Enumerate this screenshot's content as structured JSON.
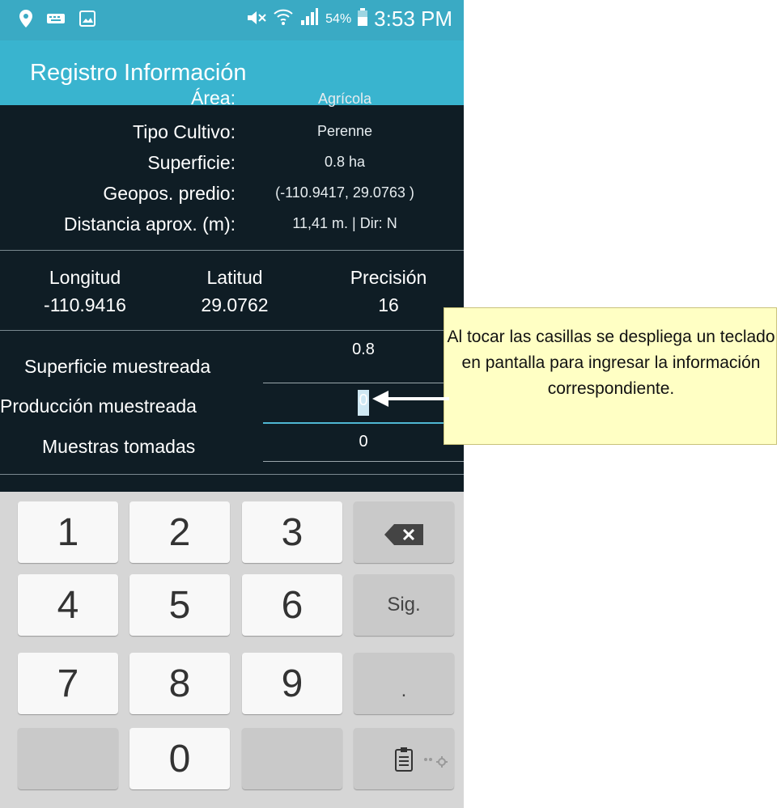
{
  "status_bar": {
    "battery_percent": "54%",
    "time": "3:53 PM"
  },
  "app": {
    "title": "Registro Información"
  },
  "info": {
    "partial_label": "Área:",
    "partial_value": "Agrícola",
    "rows": [
      {
        "label": "Tipo Cultivo:",
        "value": "Perenne"
      },
      {
        "label": "Superficie:",
        "value": "0.8 ha"
      },
      {
        "label": "Geopos. predio:",
        "value": "(-110.9417, 29.0763 )"
      },
      {
        "label": "Distancia aprox. (m):",
        "value": "11,41 m. | Dir: N"
      }
    ]
  },
  "gps": {
    "longitud_label": "Longitud",
    "longitud_value": "-110.9416",
    "latitud_label": "Latitud",
    "latitud_value": "29.0762",
    "precision_label": "Precisión",
    "precision_value": "16"
  },
  "form": {
    "superficie_label": "Superficie muestreada",
    "superficie_value": "0.8",
    "produccion_label": "Producción muestreada",
    "produccion_value": "0",
    "muestras_label": "Muestras tomadas",
    "muestras_value": "0"
  },
  "keyboard": {
    "k1": "1",
    "k2": "2",
    "k3": "3",
    "k4": "4",
    "k5": "5",
    "k6": "6",
    "k7": "7",
    "k8": "8",
    "k9": "9",
    "k0": "0",
    "next_label": "Sig.",
    "dot_label": "."
  },
  "callout": {
    "text": "Al tocar las casillas se despliega un teclado en pantalla para ingresar la información correspondiente."
  },
  "colors": {
    "status_bar": "#3aaac4",
    "app_bar": "#39b4cf",
    "content_bg": "#0f1d25",
    "keyboard_bg": "#d6d6d6",
    "callout_bg": "#ffffc4"
  }
}
